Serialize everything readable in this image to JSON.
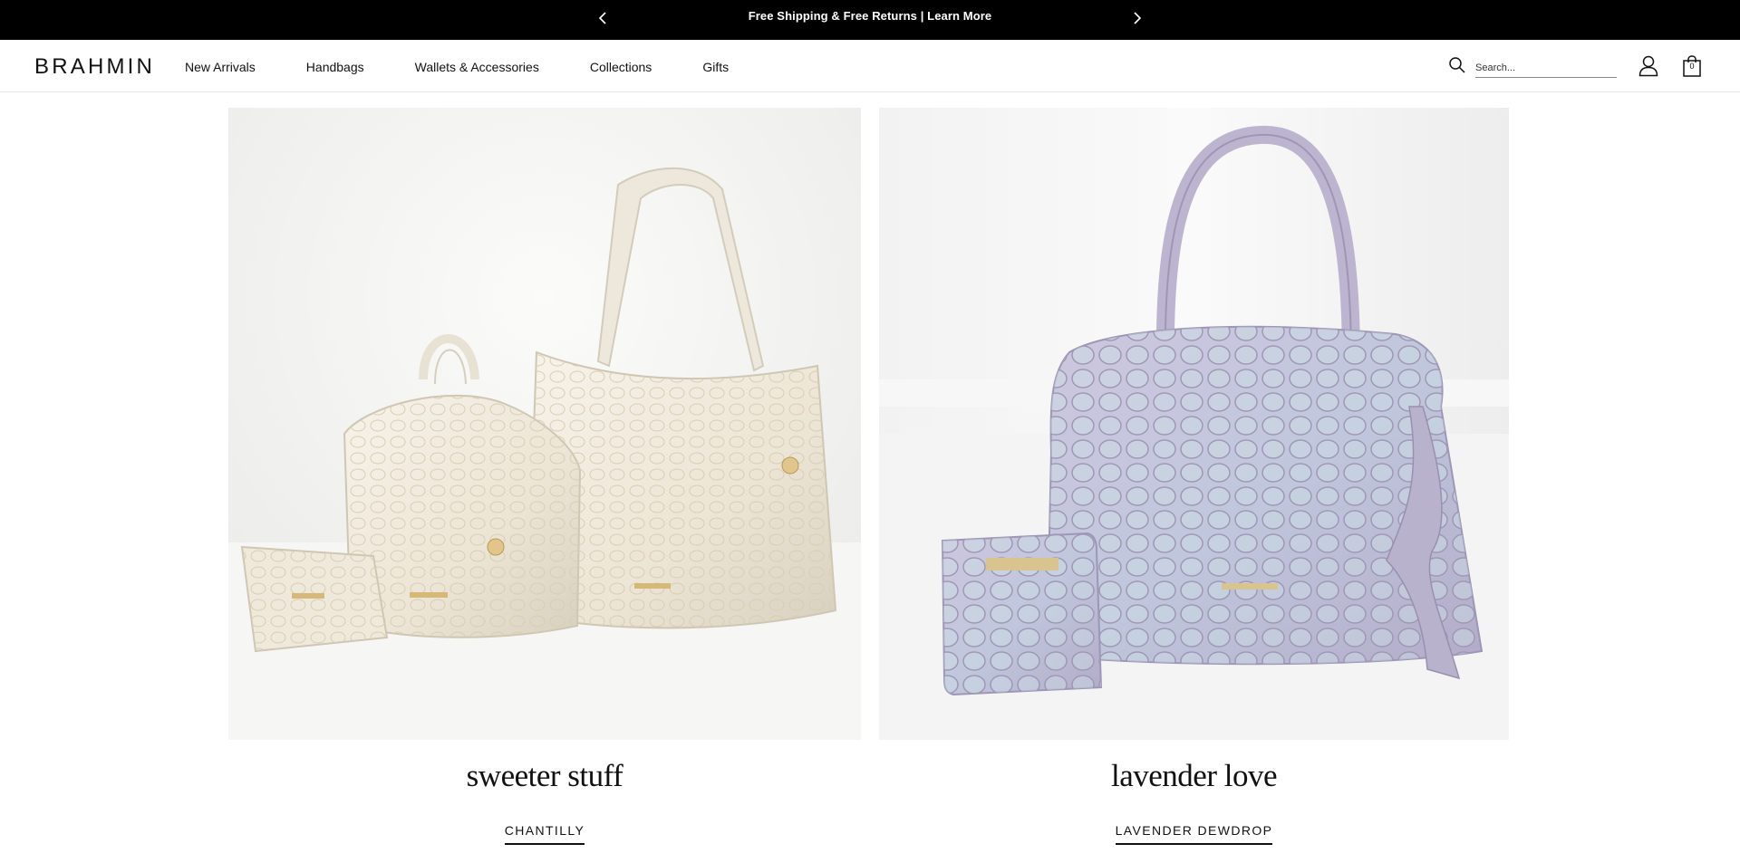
{
  "announcement": {
    "text": "Free Shipping & Free Returns | Learn More"
  },
  "header": {
    "logo": "BRAHMIN",
    "nav": [
      "New Arrivals",
      "Handbags",
      "Wallets & Accessories",
      "Collections",
      "Gifts"
    ],
    "search_placeholder": "Search...",
    "bag_count": "0"
  },
  "tiles": [
    {
      "title": "sweeter stuff",
      "link": "CHANTILLY"
    },
    {
      "title": "lavender love",
      "link": "LAVENDER DEWDROP"
    }
  ],
  "colors": {
    "announce_bg": "#000000",
    "text": "#111111",
    "chantilly": "#efe9dc",
    "lavender": "#c6bfd8"
  }
}
